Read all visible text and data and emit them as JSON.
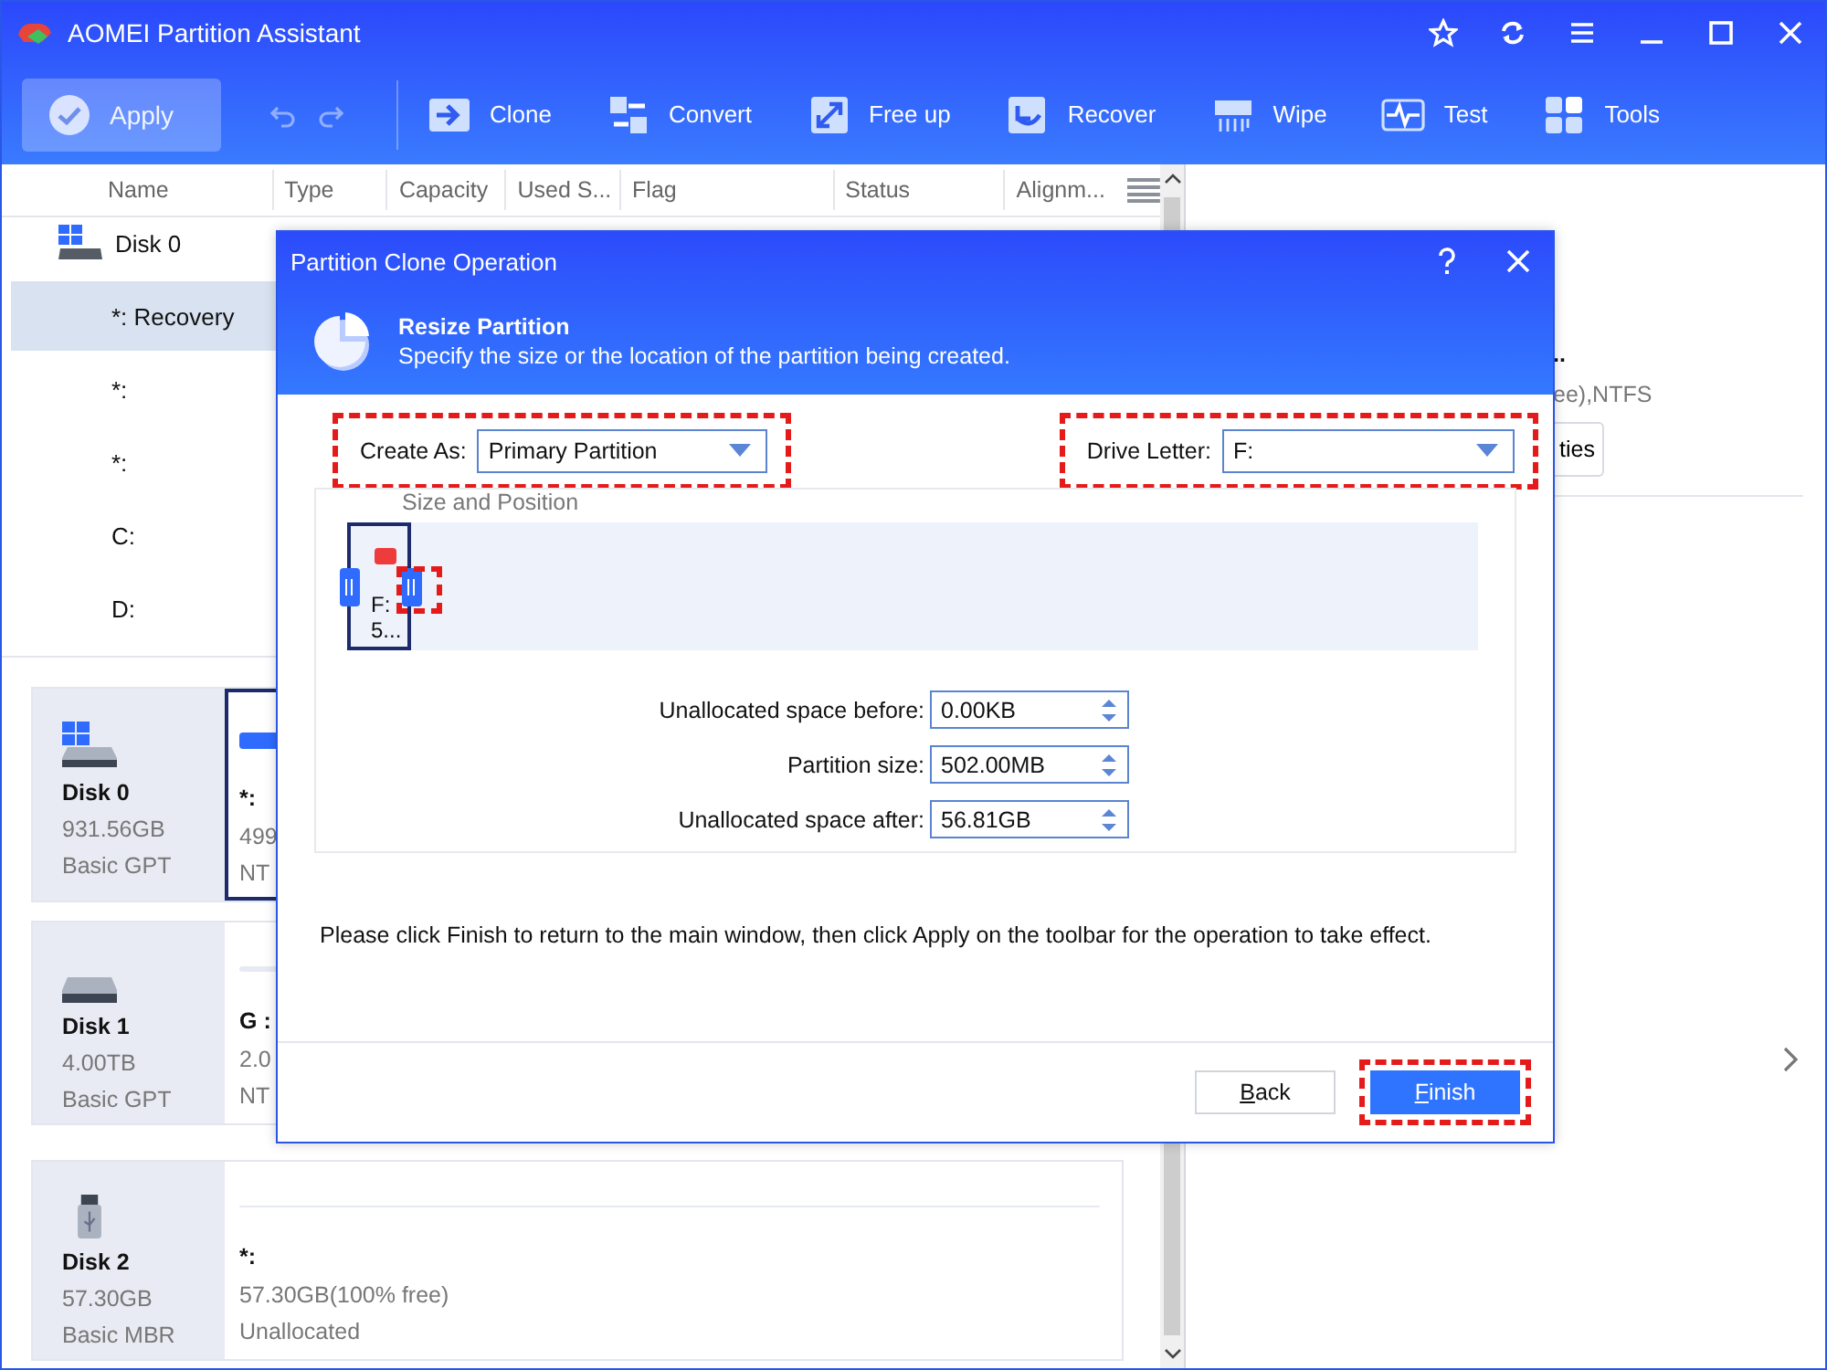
{
  "window": {
    "title": "AOMEI Partition Assistant"
  },
  "toolbar": {
    "apply": {
      "label": "Apply",
      "disabled": true
    },
    "history": [
      {
        "kind": "undo",
        "disabled": true
      },
      {
        "kind": "redo",
        "disabled": true
      }
    ],
    "tools": [
      {
        "kind": "clone",
        "label": "Clone"
      },
      {
        "kind": "convert",
        "label": "Convert"
      },
      {
        "kind": "freeup",
        "label": "Free up"
      },
      {
        "kind": "recover",
        "label": "Recover"
      },
      {
        "kind": "wipe",
        "label": "Wipe"
      },
      {
        "kind": "test",
        "label": "Test"
      },
      {
        "kind": "tools",
        "label": "Tools"
      }
    ]
  },
  "partition_table": {
    "columns": [
      "Name",
      "Type",
      "Capacity",
      "Used S...",
      "Flag",
      "Status",
      "Alignm..."
    ],
    "rows": [
      {
        "kind": "disk",
        "name": "Disk 0",
        "selected": false
      },
      {
        "kind": "partition",
        "name": "*: Recovery",
        "selected": true
      },
      {
        "kind": "partition",
        "name": "*:",
        "selected": false
      },
      {
        "kind": "partition",
        "name": "*:",
        "selected": false
      },
      {
        "kind": "partition",
        "name": "C:",
        "selected": false
      },
      {
        "kind": "partition",
        "name": "D:",
        "selected": false
      }
    ]
  },
  "disk_cards": [
    {
      "kind": "windows-disk",
      "name": "Disk 0",
      "size": "931.56GB",
      "style": "Basic GPT",
      "partition": {
        "name": "*:",
        "size": "499",
        "fs": "NT",
        "color": "#2f6bff",
        "selected": true
      }
    },
    {
      "kind": "disk",
      "name": "Disk 1",
      "size": "4.00TB",
      "style": "Basic GPT",
      "partition": {
        "name": "G :",
        "size": "2.0",
        "fs": "NT",
        "color": "#e6eaf2",
        "selected": false
      }
    },
    {
      "kind": "usb",
      "name": "Disk 2",
      "size": "57.30GB",
      "style": "Basic MBR",
      "partition": {
        "name": "*:",
        "size": "57.30GB(100% free)",
        "fs": "Unallocated",
        "color": "#e6eaf2",
        "selected": false
      }
    }
  ],
  "right_panel": {
    "title": "..",
    "detail": "ee),NTFS",
    "button": "ties"
  },
  "dialog": {
    "title": "Partition Clone Operation",
    "heading": "Resize Partition",
    "subtitle": "Specify the size or the location of the partition being created.",
    "create_as": {
      "label": "Create As:",
      "value": "Primary Partition",
      "highlighted": true
    },
    "drive_letter": {
      "label": "Drive Letter:",
      "value": "F:",
      "highlighted": true
    },
    "size_position": {
      "legend": "Size and Position",
      "partition_label": "F:",
      "partition_size": "5...",
      "right_handle_highlighted": true
    },
    "fields": [
      {
        "label": "Unallocated space before:",
        "value": "0.00KB"
      },
      {
        "label": "Partition size:",
        "value": "502.00MB"
      },
      {
        "label": "Unallocated space after:",
        "value": "56.81GB"
      }
    ],
    "message": "Please click Finish to return to the main window, then click Apply on the toolbar for the operation to take effect.",
    "buttons": [
      {
        "kind": "back",
        "label": "Back",
        "highlighted": false
      },
      {
        "kind": "finish",
        "label": "Finish",
        "highlighted": true
      }
    ]
  }
}
